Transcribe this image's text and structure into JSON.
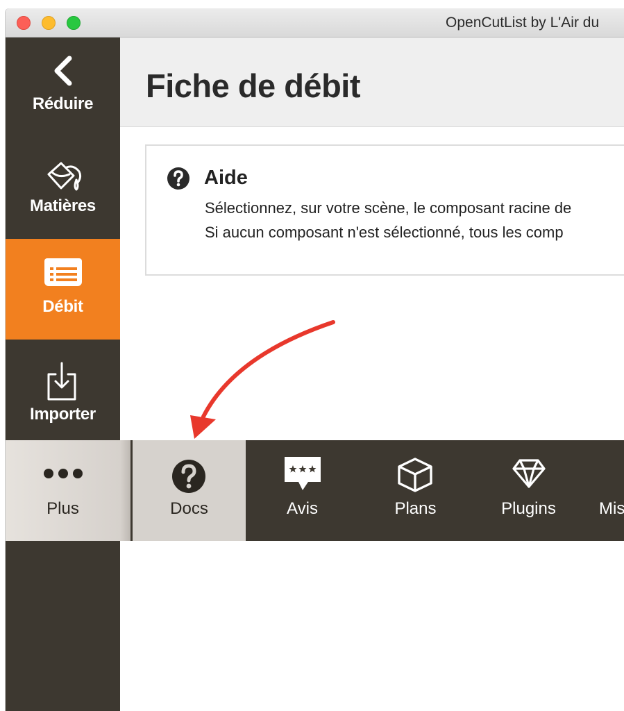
{
  "window": {
    "title": "OpenCutList by L'Air du"
  },
  "sidebar": {
    "items": [
      {
        "label": "Réduire",
        "icon": "chevron-left-icon"
      },
      {
        "label": "Matières",
        "icon": "paint-bucket-icon"
      },
      {
        "label": "Débit",
        "icon": "cutlist-icon"
      },
      {
        "label": "Importer",
        "icon": "import-icon"
      }
    ]
  },
  "header": {
    "title": "Fiche de débit"
  },
  "help": {
    "title": "Aide",
    "line1": "Sélectionnez, sur votre scène, le composant racine de",
    "line2": "Si aucun composant n'est sélectionné, tous les comp"
  },
  "tabbar": {
    "items": [
      {
        "label": "Plus",
        "icon": "more-dots-icon"
      },
      {
        "label": "Docs",
        "icon": "question-circle-icon"
      },
      {
        "label": "Avis",
        "icon": "review-bubble-icon"
      },
      {
        "label": "Plans",
        "icon": "cube-icon"
      },
      {
        "label": "Plugins",
        "icon": "diamond-icon"
      },
      {
        "label": "Mis",
        "icon": ""
      }
    ]
  },
  "colors": {
    "accent": "#f2801f",
    "sidebar": "#3d3830",
    "arrow": "#e8382c"
  }
}
